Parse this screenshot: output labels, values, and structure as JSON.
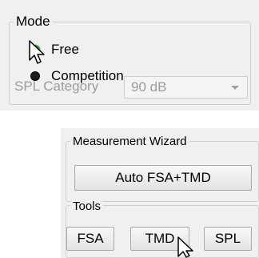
{
  "mode": {
    "title": "Mode",
    "options": [
      {
        "label": "Free",
        "checked": true
      },
      {
        "label": "Competition",
        "checked": false
      }
    ],
    "spl_category_label": "SPL Category",
    "spl_category_value": "90 dB"
  },
  "measurement_wizard": {
    "title": "Measurement Wizard",
    "button_label": "Auto FSA+TMD"
  },
  "tools": {
    "title": "Tools",
    "buttons": [
      "FSA",
      "TMD",
      "SPL"
    ]
  },
  "colors": {
    "radio_checked": "#4caf50",
    "disabled_text": "#9c9c9c"
  }
}
